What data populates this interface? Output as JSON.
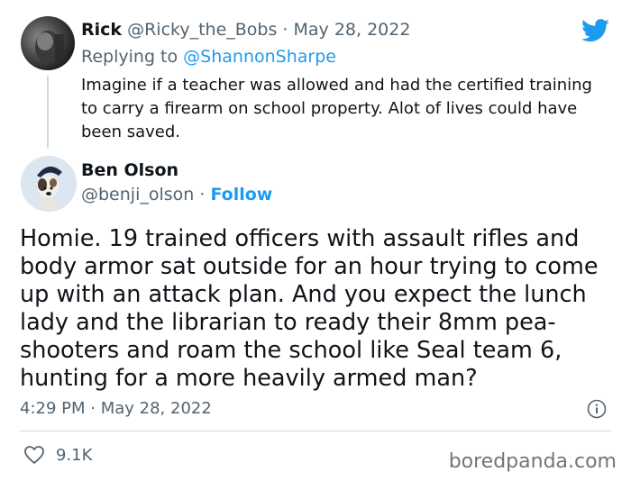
{
  "parent_tweet": {
    "name": "Rick",
    "handle": "@Ricky_the_Bobs",
    "separator": " · ",
    "date": "May 28, 2022",
    "replying_prefix": "Replying to ",
    "replying_to": "@ShannonSharpe",
    "text": "Imagine if a teacher was allowed and had the certified training to carry a firearm on school property. Alot of lives could have been saved.",
    "avatar_icon": "user-photo"
  },
  "main_tweet": {
    "name": "Ben Olson",
    "handle": "@benji_olson",
    "separator": " · ",
    "follow_label": "Follow",
    "text": "Homie. 19 trained officers with assault rifles and body armor sat outside for an hour trying to come up with an attack plan. And you expect the lunch lady and the librarian to ready their 8mm pea-shooters and roam the school like Seal team 6, hunting for a more heavily armed man?",
    "time": "4:29 PM",
    "date": "May 28, 2022",
    "likes": "9.1K",
    "avatar_icon": "dog-photo"
  },
  "watermark": "boredpanda.com",
  "colors": {
    "accent": "#1d9bf0",
    "muted": "#536471",
    "text": "#0f1419",
    "divider": "#cfd9de"
  },
  "icons": {
    "logo": "twitter-bird-icon",
    "info": "info-icon",
    "like": "heart-icon"
  }
}
